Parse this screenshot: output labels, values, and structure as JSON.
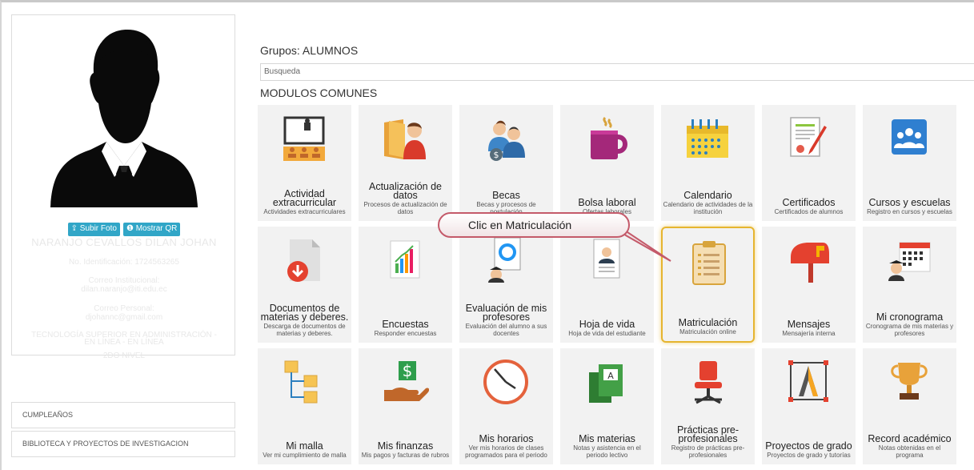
{
  "profile": {
    "upload_photo": "Subir Foto",
    "show_qr": "Mostrar QR",
    "name": "NARANJO CEVALLOS DILAN JOHAN",
    "id_line": "No. Identificación: 1724563265",
    "inst_email_label": "Correo Institucional:",
    "inst_email": "dilan.naranjo@iti.edu.ec",
    "personal_email_label": "Correo Personal:",
    "personal_email": "djohannc@gmail.com",
    "career_line1": "TECNOLOGÍA SUPERIOR EN ADMINISTRACIÓN -",
    "career_line2": "EN LÍNEA - EN LÍNEA",
    "level": "2DO NIVEL"
  },
  "side_links": [
    "CUMPLEAÑOS",
    "BIBLIOTECA Y PROYECTOS DE INVESTIGACION"
  ],
  "groups_title": "Grupos: ALUMNOS",
  "search_placeholder": "Busqueda",
  "section_title": "MODULOS COMUNES",
  "callout": "Clic en Matriculación",
  "modules": [
    {
      "name": "Actividad extracurricular",
      "desc": "Actividades extracurriculares",
      "icon": "presentation-icon"
    },
    {
      "name": "Actualización de datos",
      "desc": "Procesos de actualización de datos",
      "icon": "folder-user-icon"
    },
    {
      "name": "Becas",
      "desc": "Becas y procesos de postulación",
      "icon": "scholarship-icon"
    },
    {
      "name": "Bolsa laboral",
      "desc": "Ofertas laborales",
      "icon": "coffee-mug-icon"
    },
    {
      "name": "Calendario",
      "desc": "Calendario de actividades de la institución",
      "icon": "calendar-icon"
    },
    {
      "name": "Certificados",
      "desc": "Certificados de alumnos",
      "icon": "certificate-icon"
    },
    {
      "name": "Cursos y escuelas",
      "desc": "Registro en cursos y escuelas",
      "icon": "courses-icon"
    },
    {
      "name": "Documentos de materias y deberes.",
      "desc": "Descarga de documentos de materias y deberes.",
      "icon": "document-download-icon"
    },
    {
      "name": "Encuestas",
      "desc": "Responder encuestas",
      "icon": "survey-chart-icon"
    },
    {
      "name": "Evaluación de mis profesores",
      "desc": "Evaluación del alumno a sus docentes",
      "icon": "evaluation-icon"
    },
    {
      "name": "Hoja de vida",
      "desc": "Hoja de vida del estudiante",
      "icon": "resume-icon"
    },
    {
      "name": "Matriculación",
      "desc": "Matriculación online",
      "icon": "clipboard-icon"
    },
    {
      "name": "Mensajes",
      "desc": "Mensajería interna",
      "icon": "mailbox-icon"
    },
    {
      "name": "Mi cronograma",
      "desc": "Cronograma de mis materias y profesores",
      "icon": "schedule-icon"
    },
    {
      "name": "Mi malla",
      "desc": "Ver mi cumplimiento de malla",
      "icon": "flowchart-icon"
    },
    {
      "name": "Mis finanzas",
      "desc": "Mis pagos y facturas de rubros",
      "icon": "money-hand-icon"
    },
    {
      "name": "Mis horarios",
      "desc": "Ver mis horarios de clases programados para el periodo",
      "icon": "clock-icon"
    },
    {
      "name": "Mis materias",
      "desc": "Notas y asistencia en el periodo lectivo",
      "icon": "books-icon"
    },
    {
      "name": "Prácticas pre-profesionales",
      "desc": "Registro de prácticas pre-profesionales",
      "icon": "office-chair-icon"
    },
    {
      "name": "Proyectos de grado",
      "desc": "Proyectos de grado y tutorías",
      "icon": "design-tool-icon"
    },
    {
      "name": "Record académico",
      "desc": "Notas obtenidas en el programa",
      "icon": "trophy-icon"
    }
  ]
}
